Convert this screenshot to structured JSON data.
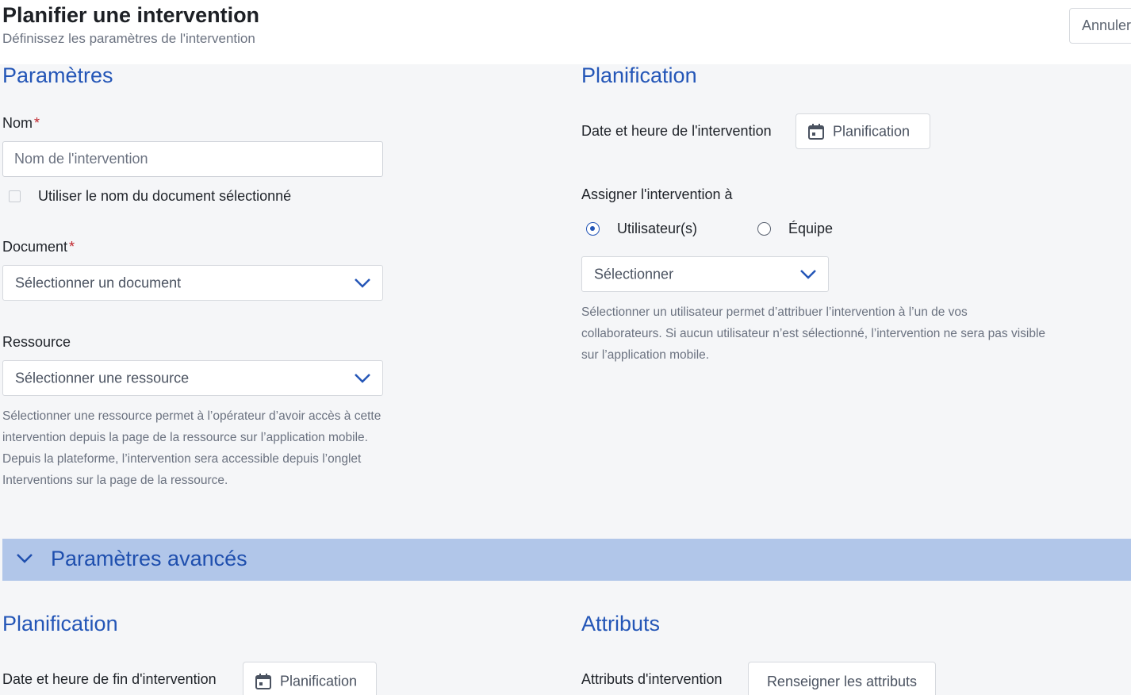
{
  "header": {
    "title": "Planifier une intervention",
    "subtitle": "Définissez les paramètres de l'intervention",
    "cancel_label": "Annuler"
  },
  "parameters": {
    "section_title": "Paramètres",
    "name_label": "Nom",
    "required_mark": "*",
    "name_placeholder": "Nom de l'intervention",
    "name_value": "",
    "use_doc_name_label": "Utiliser le nom du document sélectionné",
    "use_doc_name_checked": false,
    "document_label": "Document",
    "document_select": "Sélectionner un document",
    "resource_label": "Ressource",
    "resource_select": "Sélectionner une ressource",
    "resource_help": "Sélectionner une ressource permet à l’opérateur d’avoir accès à cette intervention depuis la page de la ressource sur l’application mobile. Depuis la plateforme, l’intervention sera accessible depuis l’onglet Interventions sur la page de la ressource."
  },
  "planning": {
    "section_title": "Planification",
    "date_label": "Date et heure de l'intervention",
    "date_button": "Planification",
    "date_icon": "calendar-icon",
    "assign_label": "Assigner l'intervention à",
    "radio_users": "Utilisateur(s)",
    "radio_team": "Équipe",
    "selected_option": "Utilisateur(s)",
    "assign_select": "Sélectionner",
    "assign_help": "Sélectionner un utilisateur permet d’attribuer l’intervention à l’un de vos collaborateurs. Si aucun utilisateur n’est sélectionné, l’intervention ne sera pas visible sur l’application mobile."
  },
  "advanced": {
    "bar_title": "Paramètres avancés",
    "expanded": true,
    "planning_title": "Planification",
    "end_date_label": "Date et heure de fin d'intervention",
    "end_date_button": "Planification",
    "attributes_title": "Attributs",
    "attributes_label": "Attributs d'intervention",
    "attributes_button": "Renseigner les attributs"
  },
  "colors": {
    "accent": "#2456b7",
    "advanced_bar": "#b1c6e9",
    "required": "#c0262d",
    "page_bg": "#f5f6f8"
  }
}
